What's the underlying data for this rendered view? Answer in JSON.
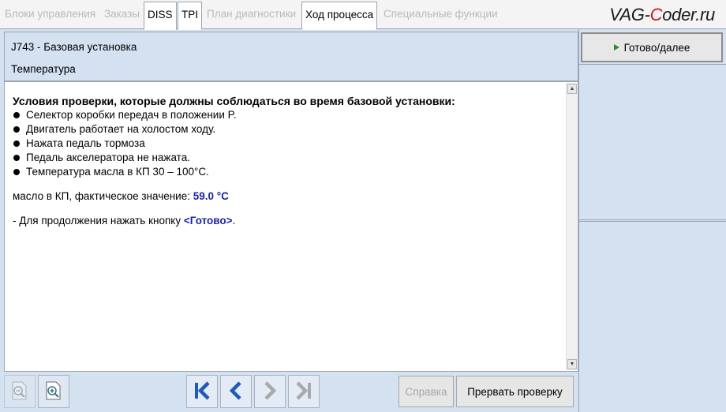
{
  "tabs": [
    {
      "label": "Блоки управления",
      "active": false
    },
    {
      "label": "Заказы",
      "active": false
    },
    {
      "label": "DISS",
      "active": true
    },
    {
      "label": "TPI",
      "active": true
    },
    {
      "label": "План диагностики",
      "active": false
    },
    {
      "label": "Ход процесса",
      "active": true
    },
    {
      "label": "Специальные функции",
      "active": false
    }
  ],
  "logo": {
    "pre": "VAG-",
    "c": "C",
    "post": "oder.ru"
  },
  "header": {
    "title": "J743 - Базовая установка",
    "subtitle": "Температура"
  },
  "content": {
    "heading": "Условия проверки, которые должны соблюдаться во время базовой установки:",
    "conditions": [
      "Селектор коробки передач в положении P.",
      "Двигатель работает на холостом ходу.",
      "Нажата педаль тормоза",
      "Педаль акселератора не нажата.",
      "Температура масла в КП 30 – 100°C."
    ],
    "measurement_label": "масло в КП, фактическое значение: ",
    "measurement_value": "59.0 °C",
    "continue_text": "- Для продолжения нажать кнопку ",
    "continue_button_ref": "<Готово>",
    "continue_end": "."
  },
  "toolbar": {
    "help_label": "Справка",
    "abort_label": "Прервать проверку"
  },
  "rightpanel": {
    "done_label": "Готово/далее"
  },
  "colors": {
    "accent_blue": "#1d23a8",
    "nav_blue": "#1f5bb8",
    "play_green": "#2f8a2f",
    "panel_bg": "#d4e1f1"
  },
  "icons": {
    "zoom_out": "zoom-out-icon",
    "zoom_in": "zoom-in-icon",
    "first": "skip-first-icon",
    "prev": "chevron-left-icon",
    "next": "chevron-right-icon",
    "last": "skip-last-icon",
    "done": "play-icon"
  }
}
